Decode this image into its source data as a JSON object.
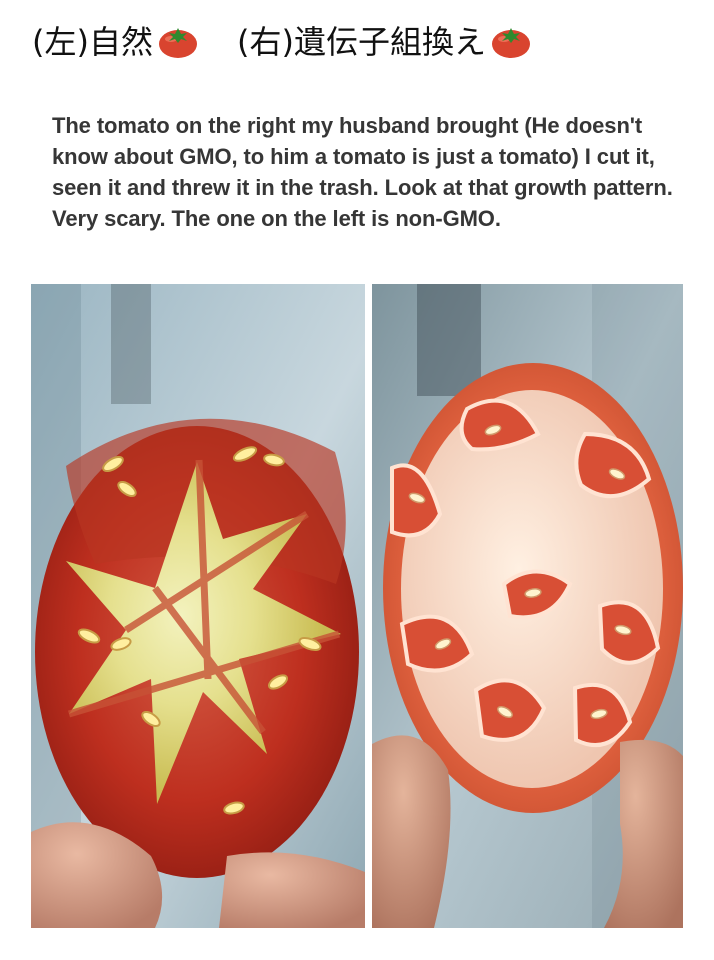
{
  "caption": {
    "left_label": "(左)自然",
    "right_label": "(右)遺伝子組換え",
    "emoji_icon": "tomato-emoji"
  },
  "post": {
    "text": "The tomato on the right my husband brought (He doesn't know about GMO, to him a tomato is just a tomato) I cut it, seen it and threw it in the trash. Look at that growth pattern. Very scary. The one on the left is non-GMO."
  },
  "colors": {
    "background": "#ffffff",
    "text": "#363636",
    "tomato_red": "#d9442f",
    "tomato_skin_left": "#c63122",
    "tomato_pulp_left": "#e6e59a",
    "tomato_skin_right": "#ea6d4b",
    "tomato_pulp_right": "#f0d2bf"
  },
  "photos": [
    {
      "label": "left-tomato-photo"
    },
    {
      "label": "right-tomato-photo"
    }
  ]
}
